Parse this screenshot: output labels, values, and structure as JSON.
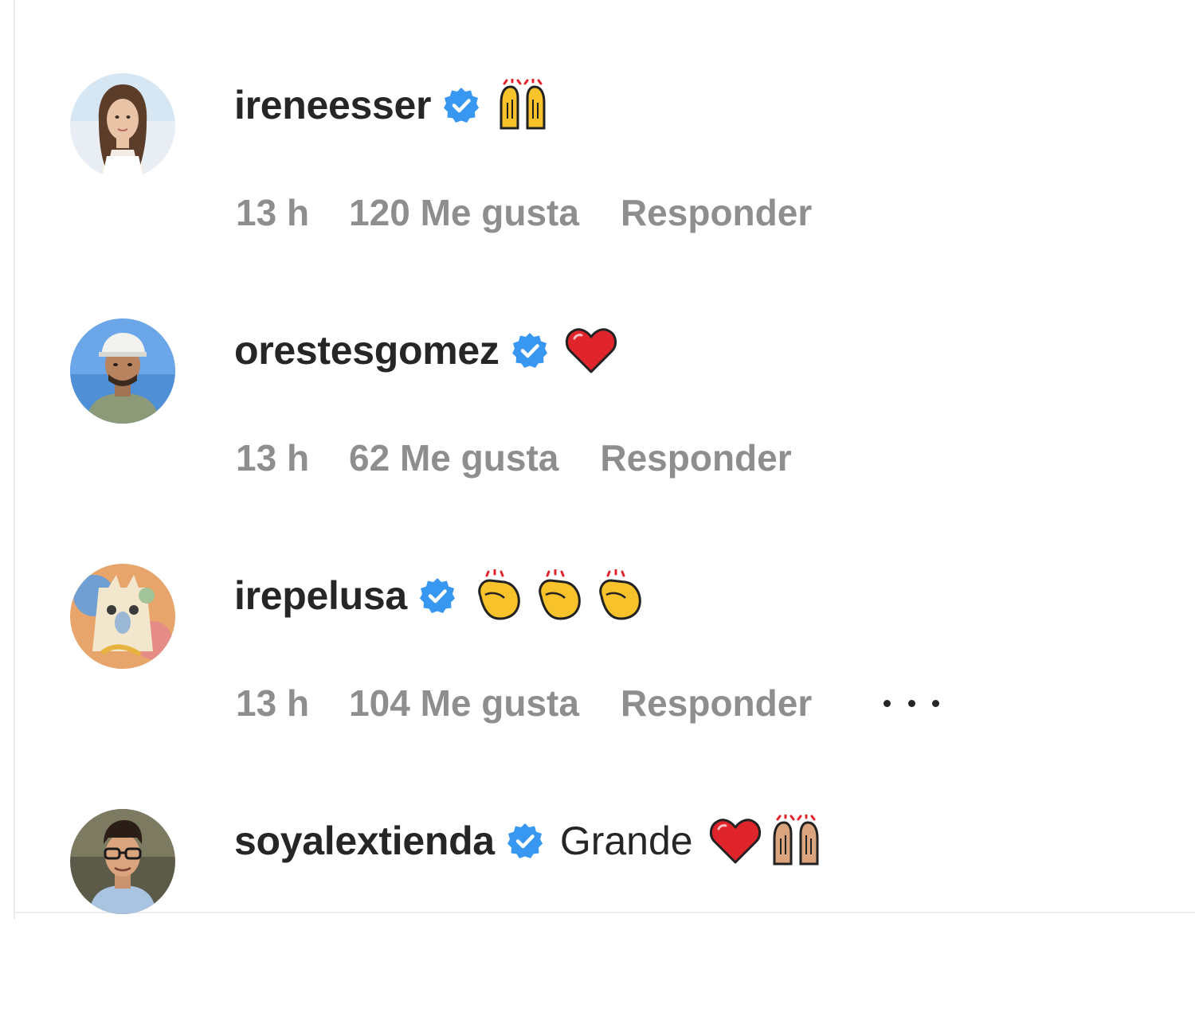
{
  "comments": [
    {
      "username": "ireneesser",
      "verified": true,
      "text": "",
      "emojis": [
        "raising-hands"
      ],
      "time": "13 h",
      "likes": "120 Me gusta",
      "reply": "Responder"
    },
    {
      "username": "orestesgomez",
      "verified": true,
      "text": "",
      "emojis": [
        "red-heart"
      ],
      "time": "13 h",
      "likes": "62 Me gusta",
      "reply": "Responder"
    },
    {
      "username": "irepelusa",
      "verified": true,
      "text": "",
      "emojis": [
        "clapping-hands",
        "clapping-hands",
        "clapping-hands"
      ],
      "time": "13 h",
      "likes": "104 Me gusta",
      "reply": "Responder",
      "more_options": true
    },
    {
      "username": "soyalextienda",
      "verified": true,
      "text": "Grande",
      "emojis": [
        "red-heart",
        "raising-hands-medium-skin"
      ]
    }
  ],
  "colors": {
    "username": "#262626",
    "meta": "#8e8e8e",
    "verified_badge": "#3897f0",
    "heart": "#e0242b",
    "emoji_yellow": "#f7c22a"
  }
}
